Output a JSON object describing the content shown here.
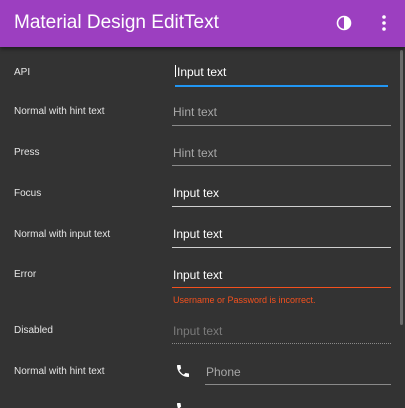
{
  "appbar": {
    "title": "Material Design EditText",
    "color": "#9c3fc0",
    "actions": [
      "contrast-icon",
      "more-vert-icon"
    ]
  },
  "rows": [
    {
      "label": "API",
      "text": "Input text",
      "state": "focused"
    },
    {
      "label": "Normal with hint text",
      "text": "Hint text",
      "state": "hint"
    },
    {
      "label": "Press",
      "text": "Hint text",
      "state": "hint"
    },
    {
      "label": "Focus",
      "text": "Input tex",
      "state": "filled"
    },
    {
      "label": "Normal with input text",
      "text": "Input text",
      "state": "filled"
    },
    {
      "label": "Error",
      "text": "Input text",
      "state": "error",
      "error": "Username or Password is incorrect."
    },
    {
      "label": "Disabled",
      "text": "Input text",
      "state": "disabled"
    },
    {
      "label": "Normal with hint text",
      "text": "Phone",
      "state": "hint",
      "icon": "phone-icon"
    }
  ],
  "colors": {
    "background": "#333333",
    "focus": "#2196f3",
    "error": "#f4511e"
  }
}
